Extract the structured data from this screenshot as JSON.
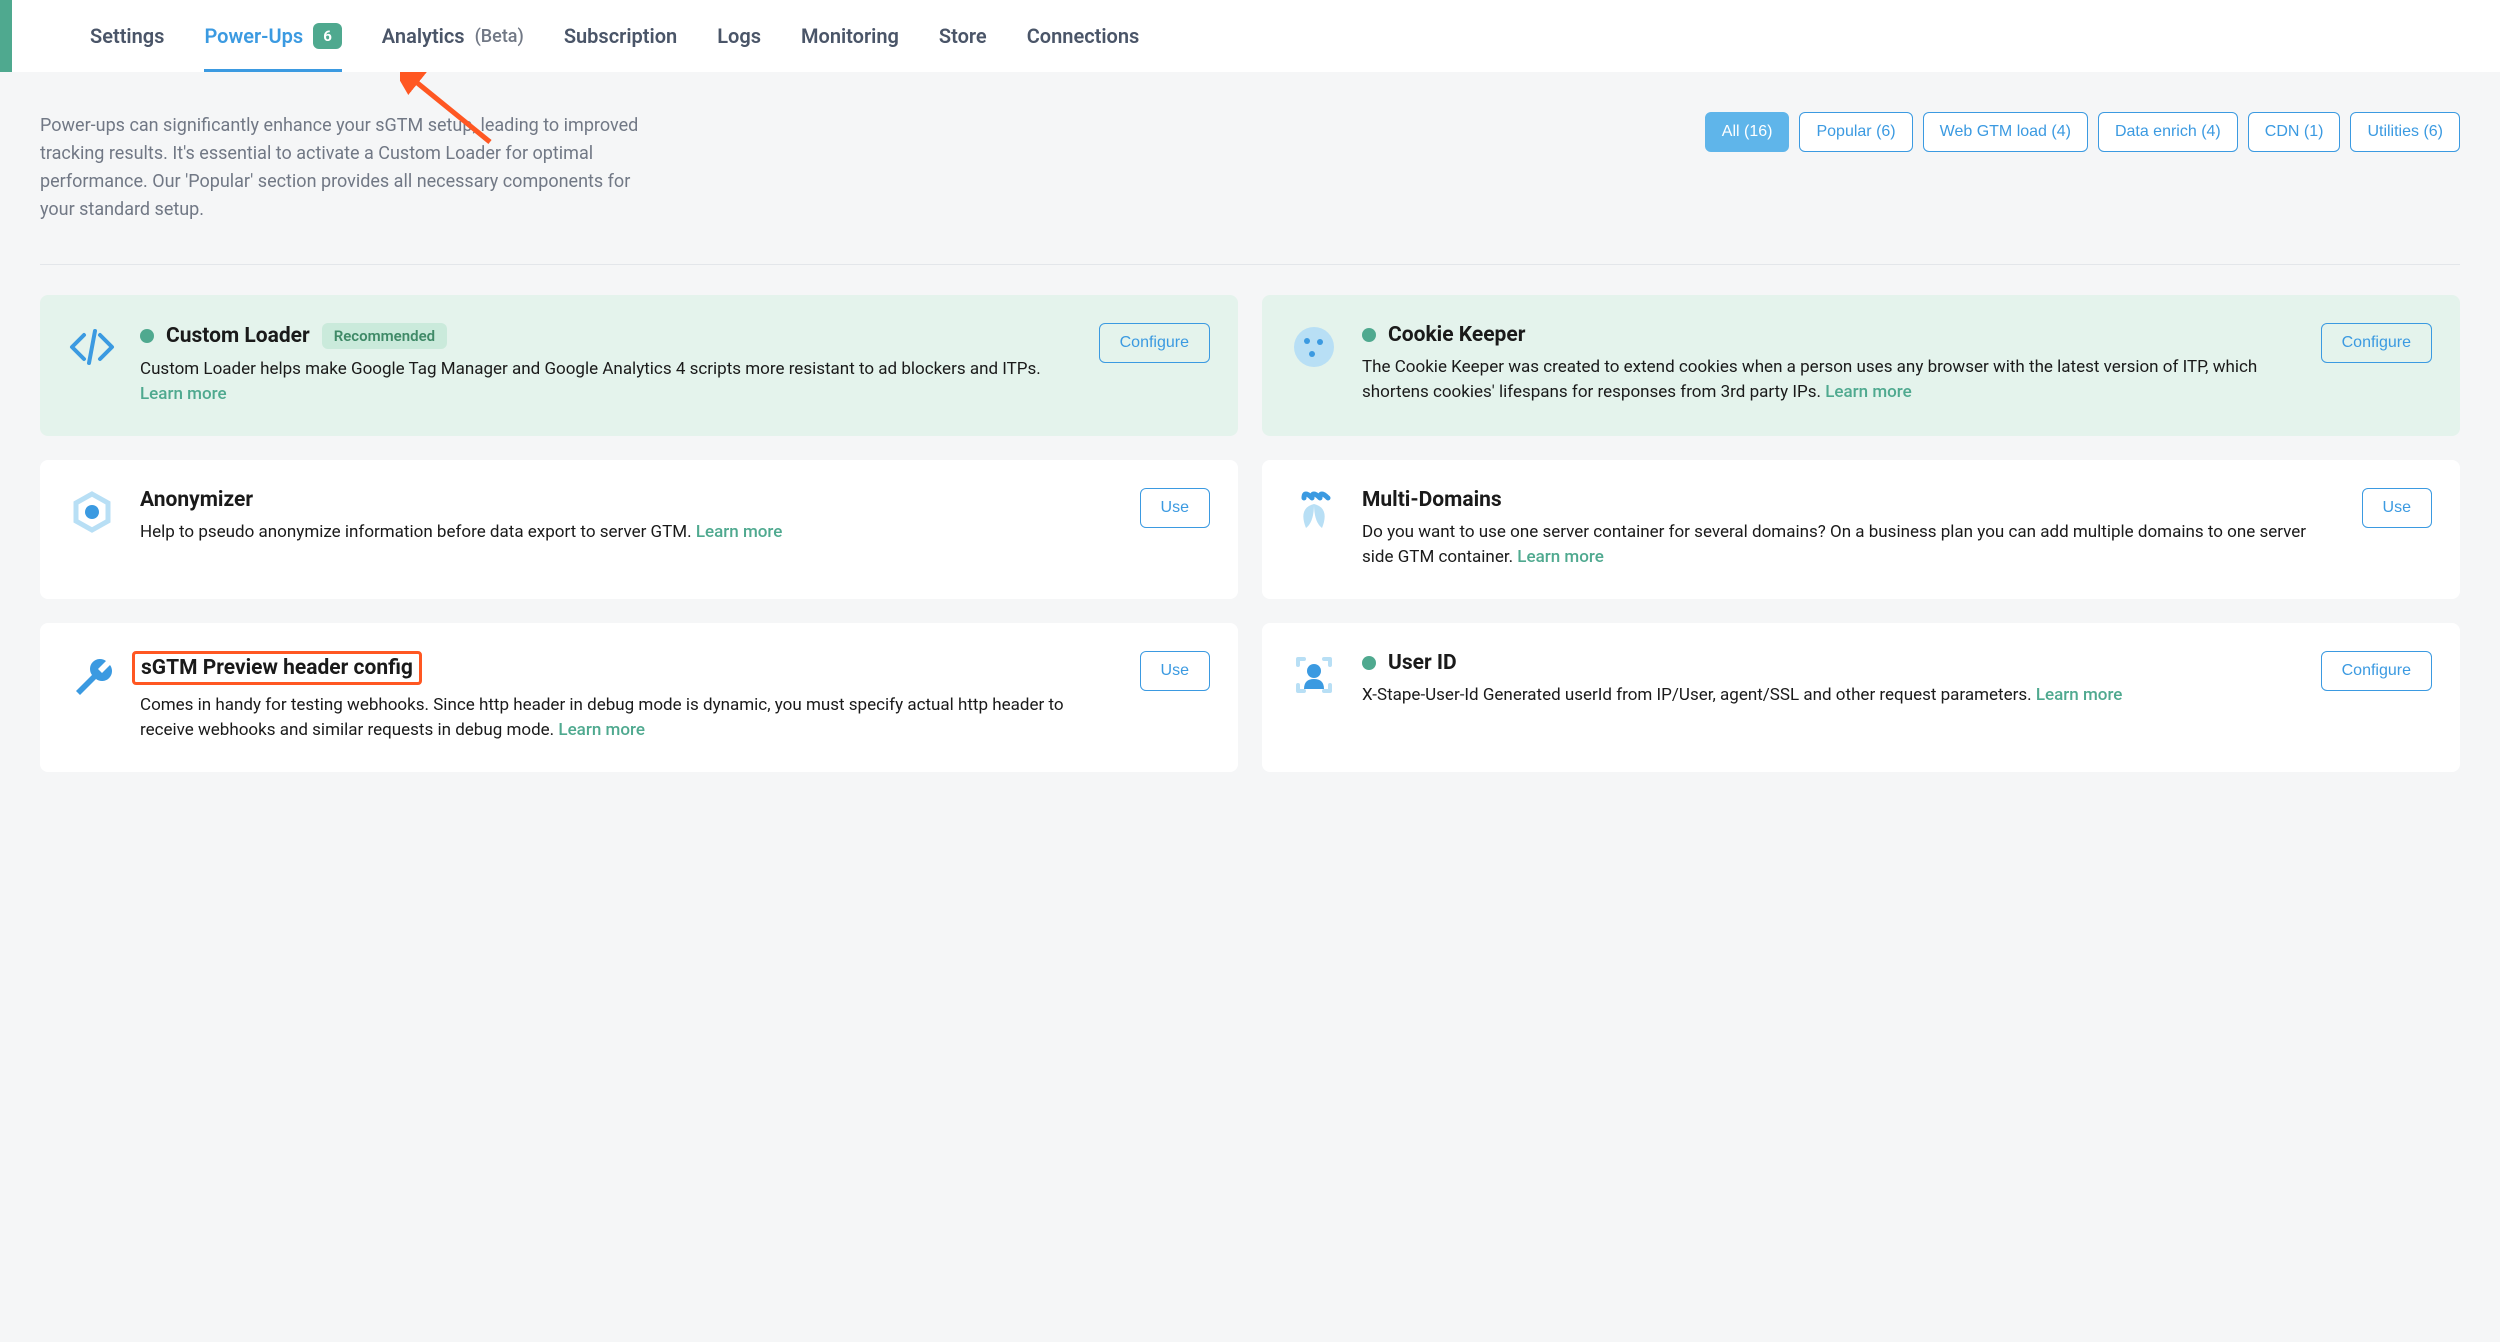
{
  "tabs": [
    {
      "label": "Settings",
      "active": false
    },
    {
      "label": "Power-Ups",
      "active": true,
      "badge": "6"
    },
    {
      "label": "Analytics",
      "active": false,
      "beta": "(Beta)"
    },
    {
      "label": "Subscription",
      "active": false
    },
    {
      "label": "Logs",
      "active": false
    },
    {
      "label": "Monitoring",
      "active": false
    },
    {
      "label": "Store",
      "active": false
    },
    {
      "label": "Connections",
      "active": false
    }
  ],
  "intro": "Power-ups can significantly enhance your sGTM setup, leading to improved tracking results. It's essential to activate a Custom Loader for optimal performance. Our 'Popular' section provides all necessary components for your standard setup.",
  "filters": [
    {
      "label": "All (16)",
      "active": true
    },
    {
      "label": "Popular (6)",
      "active": false
    },
    {
      "label": "Web GTM load (4)",
      "active": false
    },
    {
      "label": "Data enrich (4)",
      "active": false
    },
    {
      "label": "CDN (1)",
      "active": false
    },
    {
      "label": "Utilities (6)",
      "active": false
    }
  ],
  "learn_more_label": "Learn more",
  "cards": [
    {
      "title": "Custom Loader",
      "tag": "Recommended",
      "dot": true,
      "green": true,
      "desc": "Custom Loader helps make Google Tag Manager and Google Analytics 4 scripts more resistant to ad blockers and ITPs.",
      "action": "Configure",
      "icon": "code"
    },
    {
      "title": "Cookie Keeper",
      "dot": true,
      "green": true,
      "desc": "The Cookie Keeper was created to extend cookies when a person uses any browser with the latest version of ITP, which shortens cookies' lifespans for responses from 3rd party IPs.",
      "action": "Configure",
      "icon": "cookie"
    },
    {
      "title": "Anonymizer",
      "desc": "Help to pseudo anonymize information before data export to server GTM.",
      "action": "Use",
      "icon": "hex"
    },
    {
      "title": "Multi-Domains",
      "desc": "Do you want to use one server container for several domains? On a business plan you can add multiple domains to one server side GTM container.",
      "action": "Use",
      "icon": "multi"
    },
    {
      "title": "sGTM Preview header config",
      "highlight": true,
      "desc": "Comes in handy for testing webhooks. Since http header in debug mode is dynamic, you must specify actual http header to receive webhooks and similar requests in debug mode.",
      "action": "Use",
      "icon": "wrench"
    },
    {
      "title": "User ID",
      "dot": true,
      "desc": "X-Stape-User-Id Generated userId from IP/User, agent/SSL and other request parameters.",
      "action": "Configure",
      "icon": "user"
    }
  ]
}
